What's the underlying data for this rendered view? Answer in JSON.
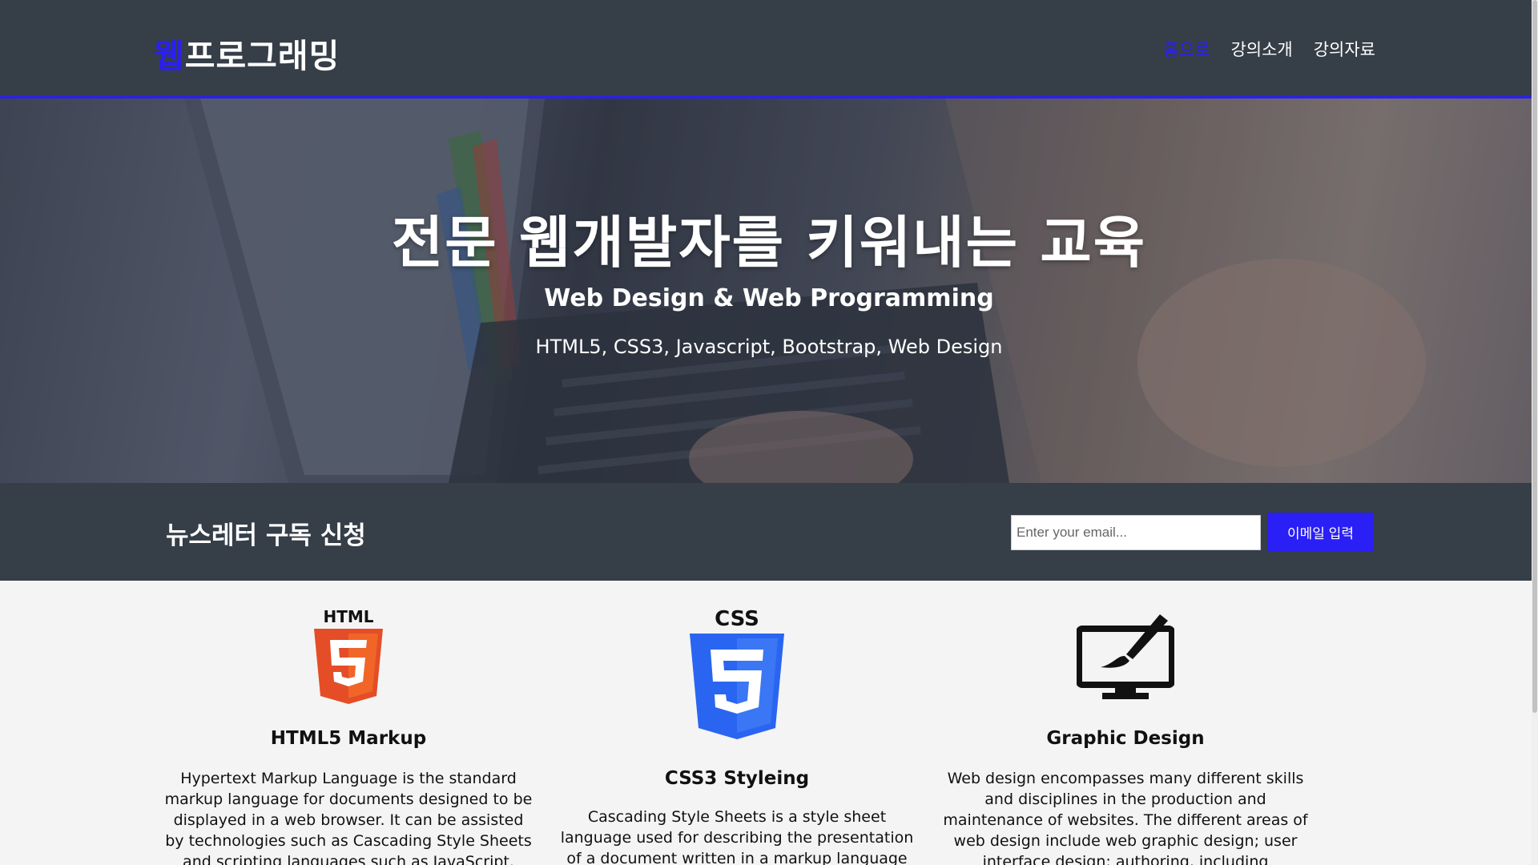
{
  "header": {
    "logo_accent": "웹",
    "logo_rest": "프로그래밍",
    "nav": [
      {
        "label": "홈으로",
        "active": true
      },
      {
        "label": "강의소개",
        "active": false
      },
      {
        "label": "강의자료",
        "active": false
      }
    ]
  },
  "hero": {
    "title": "전문 웹개발자를 키워내는 교육",
    "subtitle": "Web Design & Web Programming",
    "tags": "HTML5, CSS3, Javascript, Bootstrap, Web Design"
  },
  "newsletter": {
    "title": "뉴스레터 구독 신청",
    "email_placeholder": "Enter your email...",
    "email_value": "",
    "button_label": "이메일 입력"
  },
  "features": [
    {
      "icon": "html5-icon",
      "icon_label": "HTML",
      "title": "HTML5 Markup",
      "text": "Hypertext Markup Language is the standard markup language for documents designed to be displayed in a web browser. It can be assisted by technologies such as Cascading Style Sheets and scripting languages such as JavaScript."
    },
    {
      "icon": "css3-icon",
      "icon_label": "CSS",
      "title": "CSS3 Styleing",
      "text": "Cascading Style Sheets is a style sheet language used for describing the presentation of a document written in a markup language such as HTML. CSS is"
    },
    {
      "icon": "monitor-brush-icon",
      "title": "Graphic Design",
      "text": "Web design encompasses many different skills and disciplines in the production and maintenance of websites. The different areas of web design include web graphic design; user interface design; authoring, including standardised code and"
    }
  ],
  "colors": {
    "accent": "#2a1ff5",
    "header_bg": "#363e48",
    "page_bg": "#f4f4f4",
    "html5_orange": "#e44d26",
    "css3_blue": "#2965f1"
  }
}
